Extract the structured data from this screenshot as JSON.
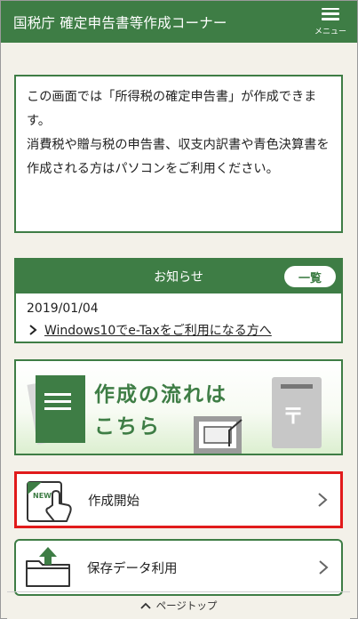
{
  "header": {
    "title": "国税庁 確定申告書等作成コーナー",
    "menu_label": "メニュー"
  },
  "notice": {
    "line1": "この画面では「所得税の確定申告書」が作成できます。",
    "line2": "消費税や贈与税の申告書、収支内訳書や青色決算書を作成される方はパソコンをご利用ください。"
  },
  "news": {
    "heading": "お知らせ",
    "list_button": "一覧",
    "date": "2019/01/04",
    "link": "Windows10でe-Taxをご利用になる方へ"
  },
  "banner": {
    "line1": "作成の流れは",
    "line2": "こちら",
    "post_symbol": "〒"
  },
  "actions": {
    "start_label": "作成開始",
    "start_badge": "NEW",
    "saved_label": "保存データ利用"
  },
  "footer": {
    "page_top": "ページトップ"
  },
  "colors": {
    "brand_green": "#3e7d45",
    "highlight_red": "#e11b1b",
    "background": "#f3f1e9"
  }
}
